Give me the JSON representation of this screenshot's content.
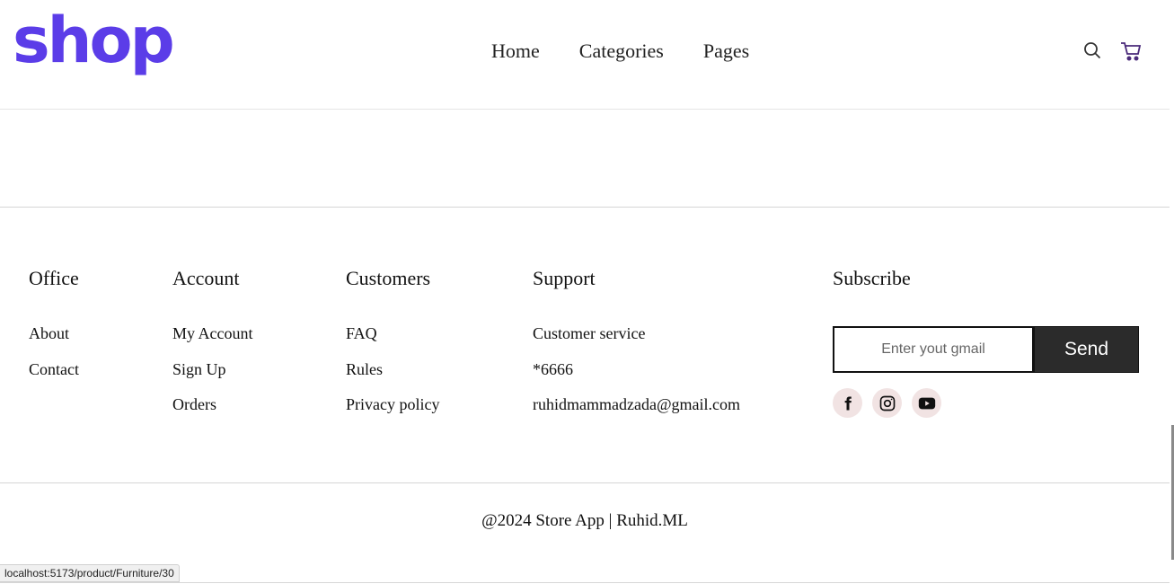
{
  "header": {
    "logo": "shop",
    "nav": [
      "Home",
      "Categories",
      "Pages"
    ],
    "icons": {
      "search": "search-icon",
      "cart": "cart-icon"
    }
  },
  "footer": {
    "columns": [
      {
        "title": "Office",
        "links": [
          "About",
          "Contact"
        ]
      },
      {
        "title": "Account",
        "links": [
          "My Account",
          "Sign Up",
          "Orders"
        ]
      },
      {
        "title": "Customers",
        "links": [
          "FAQ",
          "Rules",
          "Privacy policy"
        ]
      },
      {
        "title": "Support",
        "links": [
          "Customer service",
          "*6666",
          "ruhidmammadzada@gmail.com"
        ]
      }
    ],
    "subscribe": {
      "title": "Subscribe",
      "placeholder": "Enter yout gmail",
      "button": "Send",
      "socials": [
        "facebook-icon",
        "instagram-icon",
        "youtube-icon"
      ]
    },
    "copyright": "@2024 Store App | Ruhid.ML"
  },
  "status_bar": {
    "url": "localhost:5173/product/Furniture/30"
  },
  "colors": {
    "brand": "#5b3de8",
    "button": "#2b2b2b",
    "social_bg": "#f1e3e3"
  }
}
